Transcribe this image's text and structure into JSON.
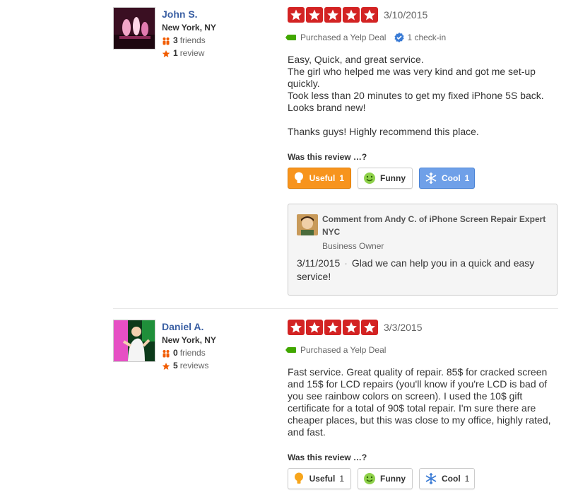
{
  "reviews": [
    {
      "user": {
        "name": "John S.",
        "location": "New York, NY",
        "friends_count": "3",
        "friends_label": "friends",
        "reviews_count": "1",
        "reviews_label": "review"
      },
      "rating": 5,
      "date": "3/10/2015",
      "deal": "Purchased a Yelp Deal",
      "checkin": "1 check-in",
      "text": [
        "Easy, Quick, and great service.",
        "The girl who helped me was very kind and got me set-up quickly.",
        "Took less than 20 minutes to get my fixed iPhone 5S back. Looks brand new!",
        "",
        "Thanks guys! Highly recommend this place."
      ],
      "was_this": "Was this review …?",
      "buttons": {
        "useful": "Useful",
        "useful_count": "1",
        "funny": "Funny",
        "funny_count": "",
        "cool": "Cool",
        "cool_count": "1"
      },
      "owner_comment": {
        "header": "Comment from Andy C. of iPhone Screen Repair Expert NYC",
        "role": "Business Owner",
        "date": "3/11/2015",
        "separator": "·",
        "text": "Glad we can help you in a quick and easy service!"
      }
    },
    {
      "user": {
        "name": "Daniel A.",
        "location": "New York, NY",
        "friends_count": "0",
        "friends_label": "friends",
        "reviews_count": "5",
        "reviews_label": "reviews"
      },
      "rating": 5,
      "date": "3/3/2015",
      "deal": "Purchased a Yelp Deal",
      "text": [
        "Fast service. Great quality of repair. 85$ for cracked screen and 15$ for LCD repairs (you'll know if you're LCD is bad of you see rainbow colors on screen). I used the 10$ gift certificate for a total of 90$ total repair. I'm sure there are cheaper places, but this was close to my office, highly rated, and fast."
      ],
      "was_this": "Was this review …?",
      "buttons": {
        "useful": "Useful",
        "useful_count": "1",
        "funny": "Funny",
        "funny_count": "",
        "cool": "Cool",
        "cool_count": "1"
      }
    }
  ],
  "colors": {
    "star": "#d32323",
    "link": "#3a5fa3",
    "deal_tag": "#41a700",
    "useful_on": "#f7941d",
    "cool_on": "#6fa0e8"
  }
}
